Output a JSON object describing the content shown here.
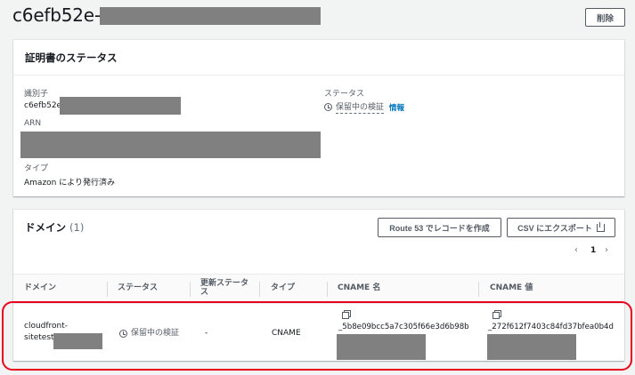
{
  "header": {
    "title": "c6efb52e-",
    "delete_label": "削除"
  },
  "status_panel": {
    "title": "証明書のステータス",
    "identifier_label": "識別子",
    "identifier_value": "c6efb52e-",
    "arn_label": "ARN",
    "type_label": "タイプ",
    "type_value": "Amazon により発行済み",
    "status_label": "ステータス",
    "status_value": "保留中の検証",
    "info_link": "情報",
    "icons": {
      "status": "clock-icon"
    }
  },
  "domain_panel": {
    "title": "ドメイン",
    "count": "(1)",
    "route53_button": "Route 53 でレコードを作成",
    "csv_button": "CSV にエクスポート",
    "pager": {
      "prev": "‹",
      "page": "1",
      "next": "›"
    },
    "columns": [
      "ドメイン",
      "ステータス",
      "更新ステータス",
      "タイプ",
      "CNAME 名",
      "CNAME 値"
    ],
    "rows": [
      {
        "domain_line1": "cloudfront-",
        "domain_line2": "sitetest.",
        "status": "保留中の検証",
        "renewal_status": "-",
        "type": "CNAME",
        "cname_name": "_5b8e09bcc5a7c305f66e3d6b98b",
        "cname_value": "_272f612f7403c84fd37bfea0b4d"
      }
    ]
  },
  "colors": {
    "highlight": "#e8001c",
    "link": "#0073bb",
    "redaction": "#808080"
  }
}
